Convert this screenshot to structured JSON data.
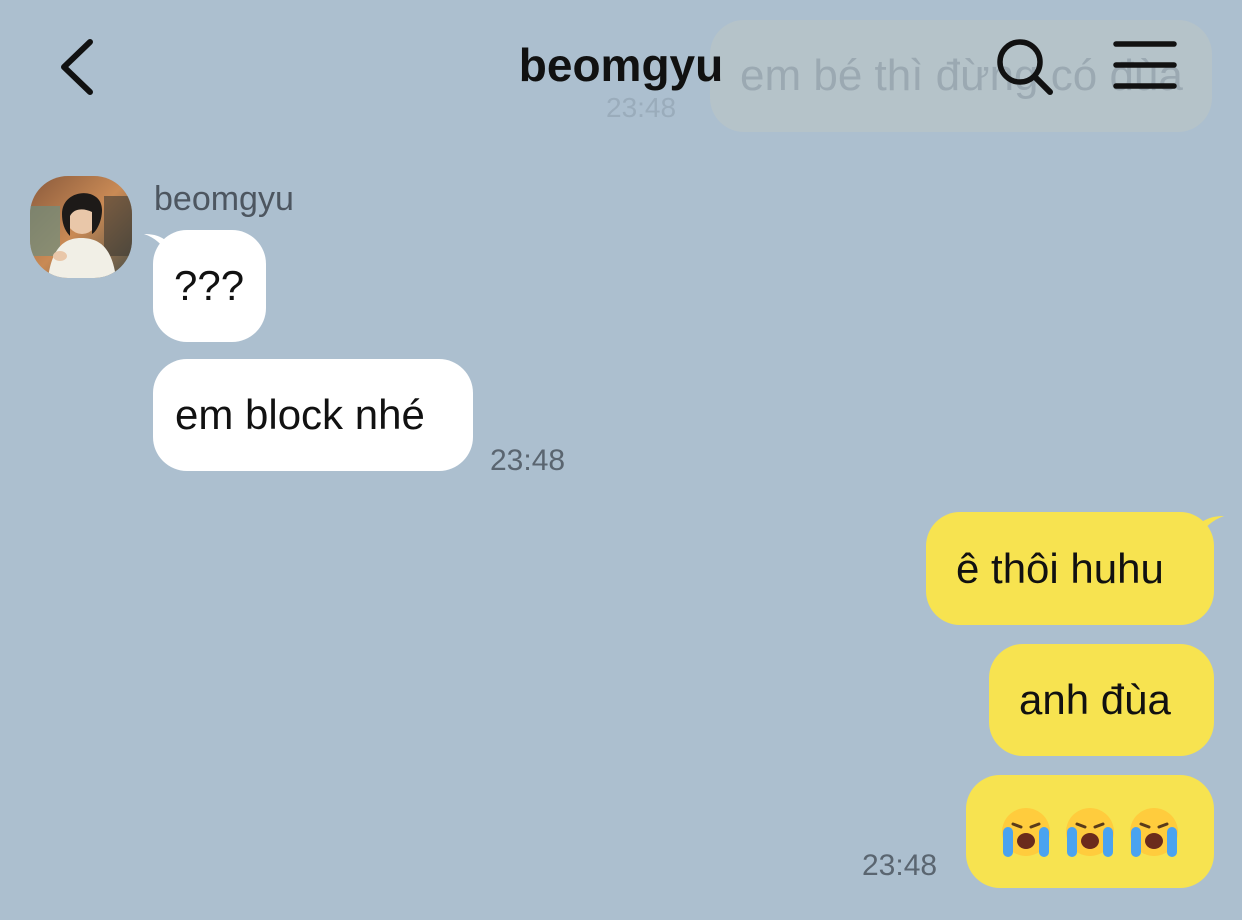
{
  "header": {
    "title": "beomgyu",
    "back_icon": "chevron-left-icon",
    "search_icon": "search-icon",
    "menu_icon": "hamburger-menu-icon"
  },
  "ghost_message": {
    "text": "em bé thì đừng có đùa",
    "time": "23:48"
  },
  "contact": {
    "name": "beomgyu"
  },
  "messages_in": [
    {
      "text": "???"
    },
    {
      "text": "em block nhé",
      "time": "23:48"
    }
  ],
  "messages_out": [
    {
      "text": "ê thôi huhu"
    },
    {
      "text": "anh đùa"
    },
    {
      "emoji": [
        "loudly-crying-face",
        "loudly-crying-face",
        "loudly-crying-face"
      ],
      "time": "23:48"
    }
  ],
  "colors": {
    "background": "#acbfcf",
    "incoming_bubble": "#ffffff",
    "outgoing_bubble": "#f7e350"
  }
}
